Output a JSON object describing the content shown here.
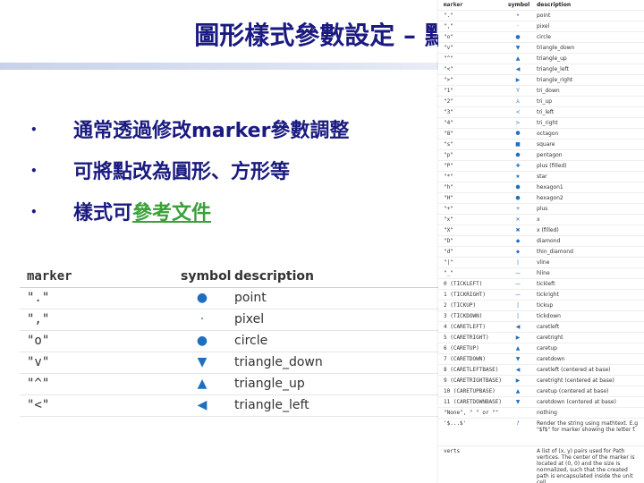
{
  "title": "圖形樣式參數設定 – 點",
  "bullets": [
    {
      "text": "通常透過修改marker參數調整"
    },
    {
      "text": "可將點改為圓形、方形等"
    },
    {
      "prefix": "樣式可",
      "link": "參考文件"
    }
  ],
  "big_table": {
    "headers": [
      "marker",
      "symbol",
      "description"
    ],
    "rows": [
      {
        "marker": "\".\"",
        "symbol": "●",
        "description": "point"
      },
      {
        "marker": "\",\"",
        "symbol": "·",
        "description": "pixel"
      },
      {
        "marker": "\"o\"",
        "symbol": "●",
        "description": "circle"
      },
      {
        "marker": "\"v\"",
        "symbol": "▼",
        "description": "triangle_down"
      },
      {
        "marker": "\"^\"",
        "symbol": "▲",
        "description": "triangle_up"
      },
      {
        "marker": "\"<\"",
        "symbol": "◀",
        "description": "triangle_left"
      }
    ]
  },
  "small_table": {
    "headers": [
      "marker",
      "symbol",
      "description"
    ],
    "rows": [
      {
        "marker": "\".\"",
        "symbol": "•",
        "description": "point"
      },
      {
        "marker": "\",\"",
        "symbol": "·",
        "description": "pixel"
      },
      {
        "marker": "\"o\"",
        "symbol": "●",
        "description": "circle"
      },
      {
        "marker": "\"v\"",
        "symbol": "▼",
        "description": "triangle_down"
      },
      {
        "marker": "\"^\"",
        "symbol": "▲",
        "description": "triangle_up"
      },
      {
        "marker": "\"<\"",
        "symbol": "◀",
        "description": "triangle_left"
      },
      {
        "marker": "\">\"",
        "symbol": "▶",
        "description": "triangle_right"
      },
      {
        "marker": "\"1\"",
        "symbol": "Y",
        "description": "tri_down"
      },
      {
        "marker": "\"2\"",
        "symbol": "⅄",
        "description": "tri_up"
      },
      {
        "marker": "\"3\"",
        "symbol": "≺",
        "description": "tri_left"
      },
      {
        "marker": "\"4\"",
        "symbol": "≻",
        "description": "tri_right"
      },
      {
        "marker": "\"8\"",
        "symbol": "⯃",
        "description": "octagon"
      },
      {
        "marker": "\"s\"",
        "symbol": "■",
        "description": "square"
      },
      {
        "marker": "\"p\"",
        "symbol": "⬟",
        "description": "pentagon"
      },
      {
        "marker": "\"P\"",
        "symbol": "✚",
        "description": "plus (filled)"
      },
      {
        "marker": "\"*\"",
        "symbol": "★",
        "description": "star"
      },
      {
        "marker": "\"h\"",
        "symbol": "⬢",
        "description": "hexagon1"
      },
      {
        "marker": "\"H\"",
        "symbol": "⬣",
        "description": "hexagon2"
      },
      {
        "marker": "\"+\"",
        "symbol": "+",
        "description": "plus"
      },
      {
        "marker": "\"x\"",
        "symbol": "✕",
        "description": "x"
      },
      {
        "marker": "\"X\"",
        "symbol": "✖",
        "description": "x (filled)"
      },
      {
        "marker": "\"D\"",
        "symbol": "◆",
        "description": "diamond"
      },
      {
        "marker": "\"d\"",
        "symbol": "⬥",
        "description": "thin_diamond"
      },
      {
        "marker": "\"|\"",
        "symbol": "|",
        "description": "vline"
      },
      {
        "marker": "\"_\"",
        "symbol": "—",
        "description": "hline"
      },
      {
        "marker": "0 (TICKLEFT)",
        "symbol": "—",
        "description": "tickleft"
      },
      {
        "marker": "1 (TICKRIGHT)",
        "symbol": "—",
        "description": "tickright"
      },
      {
        "marker": "2 (TICKUP)",
        "symbol": "|",
        "description": "tickup"
      },
      {
        "marker": "3 (TICKDOWN)",
        "symbol": "|",
        "description": "tickdown"
      },
      {
        "marker": "4 (CARETLEFT)",
        "symbol": "◀",
        "description": "caretleft"
      },
      {
        "marker": "5 (CARETRIGHT)",
        "symbol": "▶",
        "description": "caretright"
      },
      {
        "marker": "6 (CARETUP)",
        "symbol": "▲",
        "description": "caretup"
      },
      {
        "marker": "7 (CARETDOWN)",
        "symbol": "▼",
        "description": "caretdown"
      },
      {
        "marker": "8 (CARETLEFTBASE)",
        "symbol": "◀",
        "description": "caretleft (centered at base)"
      },
      {
        "marker": "9 (CARETRIGHTBASE)",
        "symbol": "▶",
        "description": "caretright (centered at base)"
      },
      {
        "marker": "10 (CARETUPBASE)",
        "symbol": "▲",
        "description": "caretup (centered at base)"
      },
      {
        "marker": "11 (CARETDOWNBASE)",
        "symbol": "▼",
        "description": "caretdown (centered at base)"
      },
      {
        "marker": "\"None\", \" \" or \"\"",
        "symbol": "",
        "description": "nothing"
      },
      {
        "marker": "'$...$'",
        "symbol": "𝑓",
        "description": "Render the string using mathtext. E.g \"$f$\" for marker showing the letter f."
      },
      {
        "marker": "verts",
        "symbol": "",
        "description": "A list of (x, y) pairs used for Path vertices. The center of the marker is located at (0, 0) and the size is normalized, such that the created path is encapsulated inside the unit cell."
      }
    ]
  }
}
